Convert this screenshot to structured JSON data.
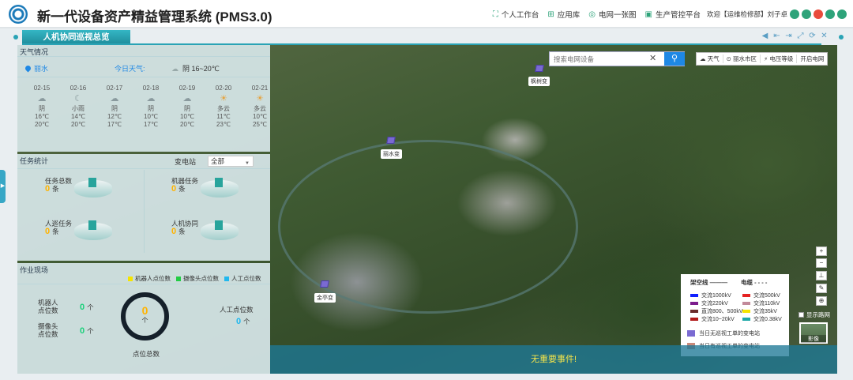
{
  "header": {
    "title": "新一代设备资产精益管理系统 (PMS3.0)",
    "nav": [
      "个人工作台",
      "应用库",
      "电网一张图",
      "生产管控平台"
    ],
    "welcome": "欢迎【运维检修部】刘子卓"
  },
  "tab": {
    "label": "人机协同巡视总览"
  },
  "weather": {
    "title": "天气情况",
    "location": "丽水",
    "today_label": "今日天气:",
    "today_cond": "阴  16~20℃",
    "days": [
      {
        "date": "02-15",
        "cond": "阴",
        "high": "16℃",
        "low": "20℃"
      },
      {
        "date": "02-16",
        "cond": "小雨",
        "high": "14℃",
        "low": "20℃"
      },
      {
        "date": "02-17",
        "cond": "阴",
        "high": "12℃",
        "low": "17℃"
      },
      {
        "date": "02-18",
        "cond": "阴",
        "high": "10℃",
        "low": "17℃"
      },
      {
        "date": "02-19",
        "cond": "阴",
        "high": "10℃",
        "low": "20℃"
      },
      {
        "date": "02-20",
        "cond": "多云",
        "high": "11℃",
        "low": "23℃"
      },
      {
        "date": "02-21",
        "cond": "多云",
        "high": "10℃",
        "low": "25℃"
      }
    ]
  },
  "tasks": {
    "title": "任务统计",
    "substation_label": "变电站",
    "select_value": "全部",
    "stats": [
      {
        "label": "任务总数",
        "value": "0",
        "unit": "条"
      },
      {
        "label": "机器任务",
        "value": "0",
        "unit": "条"
      },
      {
        "label": "人巡任务",
        "value": "0",
        "unit": "条"
      },
      {
        "label": "人机协同",
        "value": "0",
        "unit": "条"
      }
    ]
  },
  "work": {
    "title": "作业现场",
    "legend": [
      {
        "label": "机器人点位数",
        "color": "#f5e400"
      },
      {
        "label": "摄像头点位数",
        "color": "#22cc44"
      },
      {
        "label": "人工点位数",
        "color": "#21b8ee"
      }
    ],
    "robot_label": "机器人\n点位数",
    "robot_value": "0",
    "camera_label": "摄像头\n点位数",
    "camera_value": "0",
    "manual_label": "人工点位数",
    "manual_value": "0",
    "unit": "个",
    "total_value": "0",
    "total_unit": "个",
    "total_label": "点位总数"
  },
  "map": {
    "search_placeholder": "搜索电网设备",
    "tools": [
      "天气",
      "丽水市区",
      "电压等级",
      "开启电网"
    ],
    "substations": [
      "枫树变",
      "丽水变",
      "金亭变"
    ],
    "event": "无重要事件!",
    "legend": {
      "overhead": "架空线",
      "cable": "电缆",
      "items": [
        {
          "label": "交流1000kV",
          "color": "#1020ff"
        },
        {
          "label": "交流500kV",
          "color": "#e52222"
        },
        {
          "label": "交流220kV",
          "color": "#7c1c8c"
        },
        {
          "label": "交流110kV",
          "color": "#c28a9a"
        },
        {
          "label": "直流800、500kV",
          "color": "#6a2a2a"
        },
        {
          "label": "交流35kV",
          "color": "#f5e400"
        },
        {
          "label": "交流10~20kV",
          "color": "#b01818"
        },
        {
          "label": "交流0.38kV",
          "color": "#1ea8a8"
        }
      ],
      "sub1": "当日无巡视工单的变电站",
      "sub2": "当日有巡视工单的变电站"
    },
    "show_road": "显示路网",
    "imagery": "影像"
  }
}
